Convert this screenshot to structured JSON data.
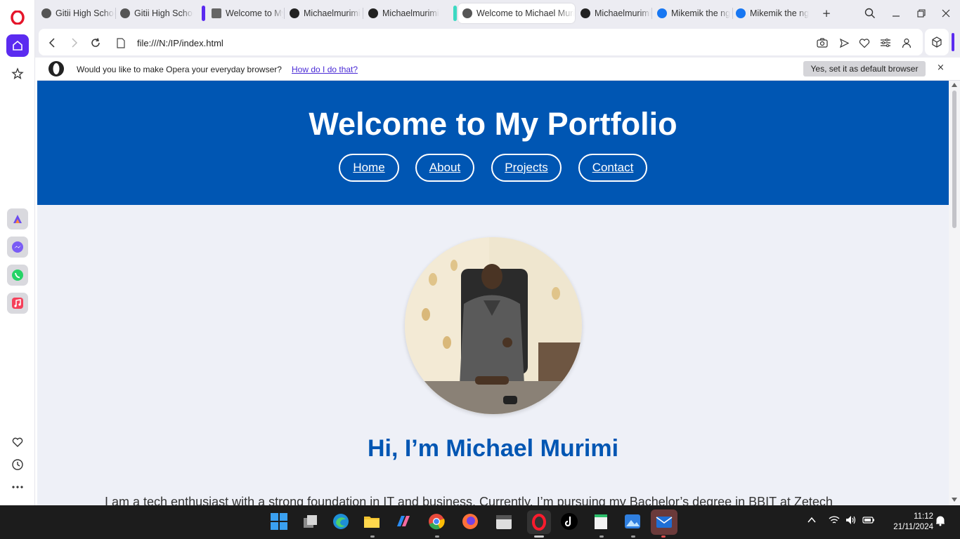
{
  "tabs": [
    {
      "title": "Gitii High School",
      "icon": "globe-icon"
    },
    {
      "title": "Gitii High School",
      "icon": "globe-icon"
    },
    {
      "title": "Welcome to My Portfolio",
      "icon": "page-icon"
    },
    {
      "title": "Michaelmurimi",
      "icon": "github-icon"
    },
    {
      "title": "Michaelmurimi",
      "icon": "github-icon"
    },
    {
      "title": "Welcome to Michael Murimi",
      "icon": "globe-icon",
      "active": true
    },
    {
      "title": "Michaelmurimi",
      "icon": "github-icon"
    },
    {
      "title": "Mikemik the ng",
      "icon": "facebook-icon"
    },
    {
      "title": "Mikemik the ng",
      "icon": "facebook-icon"
    }
  ],
  "address": {
    "url": "file:///N:/IP/index.html"
  },
  "banner": {
    "text": "Would you like to make Opera your everyday browser?",
    "link": "How do I do that?",
    "button": "Yes, set it as default browser",
    "close": "×"
  },
  "site": {
    "title": "Welcome to My Portfolio",
    "nav": [
      "Home",
      "About",
      "Projects",
      "Contact"
    ],
    "greeting": "Hi, I’m Michael Murimi",
    "intro": "I am a tech enthusiast with a strong foundation in IT and business. Currently, I’m pursuing my Bachelor’s degree in BBIT at Zetech"
  },
  "colors": {
    "header": "#0056b3",
    "accent": "#5b2bf0",
    "page_bg": "#eef0f7"
  },
  "taskbar": {
    "time": "11:12",
    "date": "21/11/2024"
  }
}
